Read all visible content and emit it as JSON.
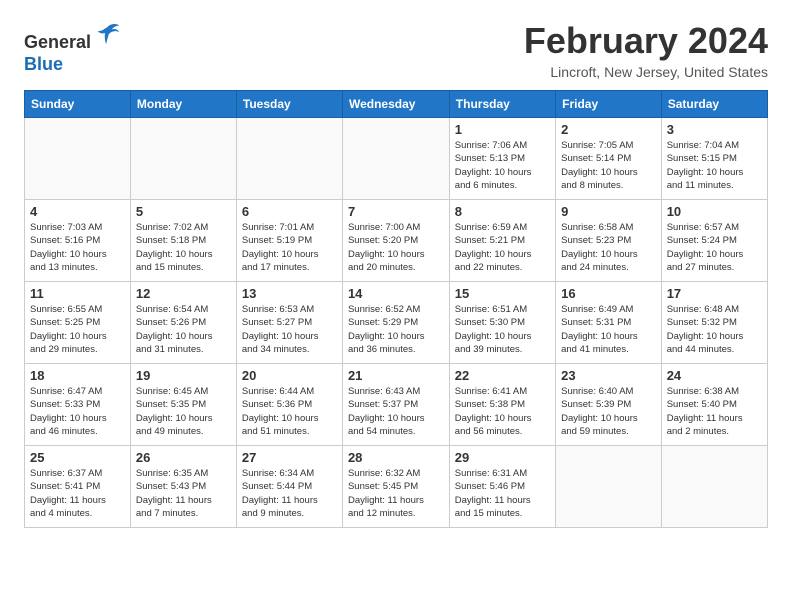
{
  "header": {
    "logo_line1": "General",
    "logo_line2": "Blue",
    "month": "February 2024",
    "location": "Lincroft, New Jersey, United States"
  },
  "days_of_week": [
    "Sunday",
    "Monday",
    "Tuesday",
    "Wednesday",
    "Thursday",
    "Friday",
    "Saturday"
  ],
  "weeks": [
    [
      {
        "day": "",
        "info": ""
      },
      {
        "day": "",
        "info": ""
      },
      {
        "day": "",
        "info": ""
      },
      {
        "day": "",
        "info": ""
      },
      {
        "day": "1",
        "info": "Sunrise: 7:06 AM\nSunset: 5:13 PM\nDaylight: 10 hours\nand 6 minutes."
      },
      {
        "day": "2",
        "info": "Sunrise: 7:05 AM\nSunset: 5:14 PM\nDaylight: 10 hours\nand 8 minutes."
      },
      {
        "day": "3",
        "info": "Sunrise: 7:04 AM\nSunset: 5:15 PM\nDaylight: 10 hours\nand 11 minutes."
      }
    ],
    [
      {
        "day": "4",
        "info": "Sunrise: 7:03 AM\nSunset: 5:16 PM\nDaylight: 10 hours\nand 13 minutes."
      },
      {
        "day": "5",
        "info": "Sunrise: 7:02 AM\nSunset: 5:18 PM\nDaylight: 10 hours\nand 15 minutes."
      },
      {
        "day": "6",
        "info": "Sunrise: 7:01 AM\nSunset: 5:19 PM\nDaylight: 10 hours\nand 17 minutes."
      },
      {
        "day": "7",
        "info": "Sunrise: 7:00 AM\nSunset: 5:20 PM\nDaylight: 10 hours\nand 20 minutes."
      },
      {
        "day": "8",
        "info": "Sunrise: 6:59 AM\nSunset: 5:21 PM\nDaylight: 10 hours\nand 22 minutes."
      },
      {
        "day": "9",
        "info": "Sunrise: 6:58 AM\nSunset: 5:23 PM\nDaylight: 10 hours\nand 24 minutes."
      },
      {
        "day": "10",
        "info": "Sunrise: 6:57 AM\nSunset: 5:24 PM\nDaylight: 10 hours\nand 27 minutes."
      }
    ],
    [
      {
        "day": "11",
        "info": "Sunrise: 6:55 AM\nSunset: 5:25 PM\nDaylight: 10 hours\nand 29 minutes."
      },
      {
        "day": "12",
        "info": "Sunrise: 6:54 AM\nSunset: 5:26 PM\nDaylight: 10 hours\nand 31 minutes."
      },
      {
        "day": "13",
        "info": "Sunrise: 6:53 AM\nSunset: 5:27 PM\nDaylight: 10 hours\nand 34 minutes."
      },
      {
        "day": "14",
        "info": "Sunrise: 6:52 AM\nSunset: 5:29 PM\nDaylight: 10 hours\nand 36 minutes."
      },
      {
        "day": "15",
        "info": "Sunrise: 6:51 AM\nSunset: 5:30 PM\nDaylight: 10 hours\nand 39 minutes."
      },
      {
        "day": "16",
        "info": "Sunrise: 6:49 AM\nSunset: 5:31 PM\nDaylight: 10 hours\nand 41 minutes."
      },
      {
        "day": "17",
        "info": "Sunrise: 6:48 AM\nSunset: 5:32 PM\nDaylight: 10 hours\nand 44 minutes."
      }
    ],
    [
      {
        "day": "18",
        "info": "Sunrise: 6:47 AM\nSunset: 5:33 PM\nDaylight: 10 hours\nand 46 minutes."
      },
      {
        "day": "19",
        "info": "Sunrise: 6:45 AM\nSunset: 5:35 PM\nDaylight: 10 hours\nand 49 minutes."
      },
      {
        "day": "20",
        "info": "Sunrise: 6:44 AM\nSunset: 5:36 PM\nDaylight: 10 hours\nand 51 minutes."
      },
      {
        "day": "21",
        "info": "Sunrise: 6:43 AM\nSunset: 5:37 PM\nDaylight: 10 hours\nand 54 minutes."
      },
      {
        "day": "22",
        "info": "Sunrise: 6:41 AM\nSunset: 5:38 PM\nDaylight: 10 hours\nand 56 minutes."
      },
      {
        "day": "23",
        "info": "Sunrise: 6:40 AM\nSunset: 5:39 PM\nDaylight: 10 hours\nand 59 minutes."
      },
      {
        "day": "24",
        "info": "Sunrise: 6:38 AM\nSunset: 5:40 PM\nDaylight: 11 hours\nand 2 minutes."
      }
    ],
    [
      {
        "day": "25",
        "info": "Sunrise: 6:37 AM\nSunset: 5:41 PM\nDaylight: 11 hours\nand 4 minutes."
      },
      {
        "day": "26",
        "info": "Sunrise: 6:35 AM\nSunset: 5:43 PM\nDaylight: 11 hours\nand 7 minutes."
      },
      {
        "day": "27",
        "info": "Sunrise: 6:34 AM\nSunset: 5:44 PM\nDaylight: 11 hours\nand 9 minutes."
      },
      {
        "day": "28",
        "info": "Sunrise: 6:32 AM\nSunset: 5:45 PM\nDaylight: 11 hours\nand 12 minutes."
      },
      {
        "day": "29",
        "info": "Sunrise: 6:31 AM\nSunset: 5:46 PM\nDaylight: 11 hours\nand 15 minutes."
      },
      {
        "day": "",
        "info": ""
      },
      {
        "day": "",
        "info": ""
      }
    ]
  ]
}
